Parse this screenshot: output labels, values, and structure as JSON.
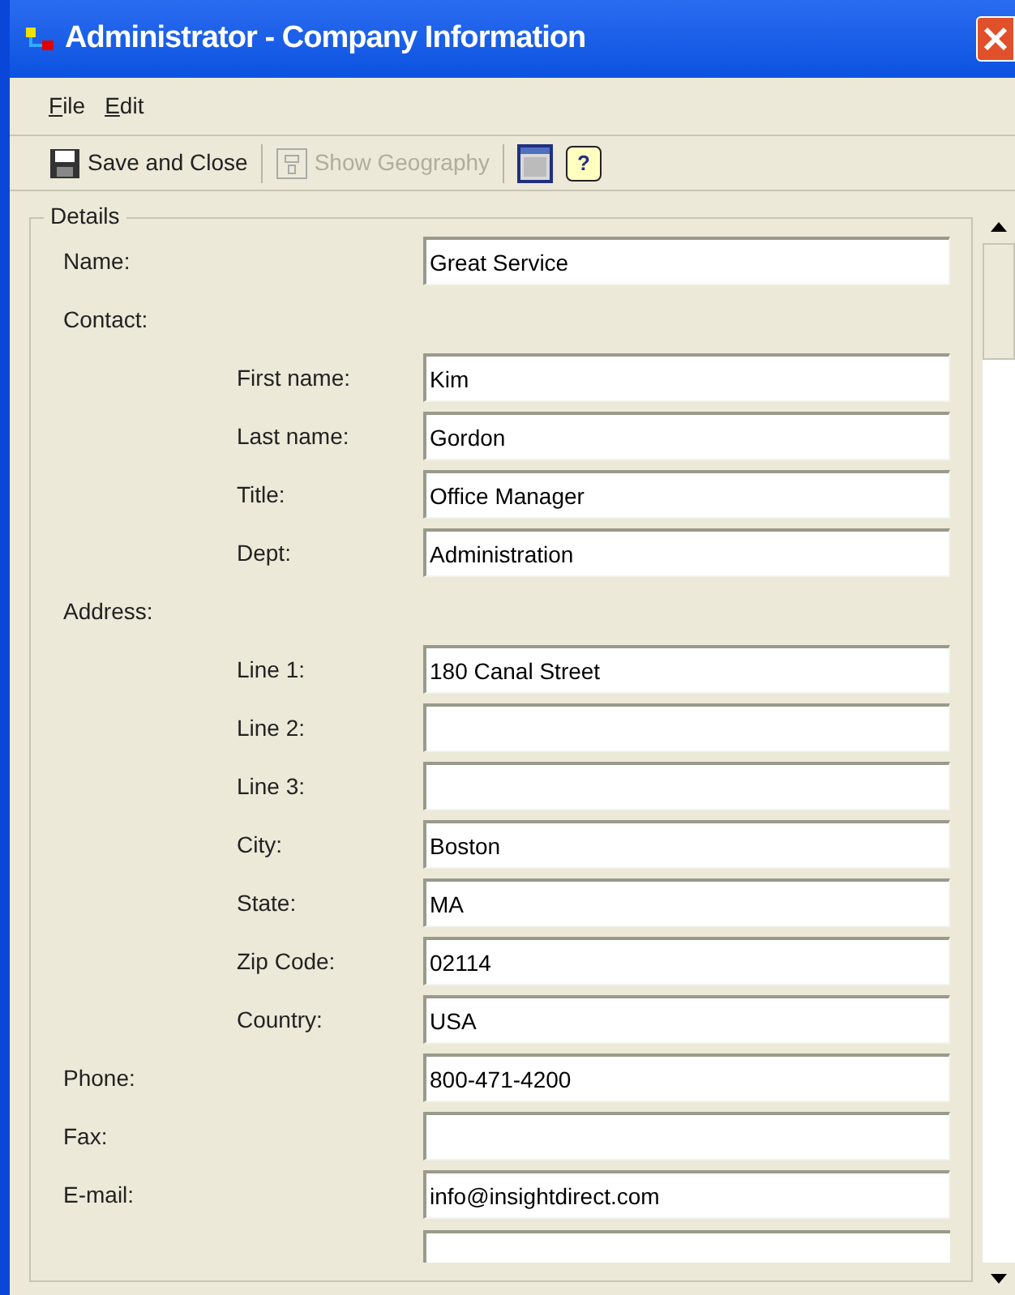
{
  "window": {
    "title": "Administrator - Company Information"
  },
  "menu": [
    {
      "label": "File"
    },
    {
      "label": "Edit"
    }
  ],
  "toolbar": [
    {
      "kind": "save",
      "label": "Save and Close",
      "disabled": false
    },
    {
      "kind": "geography",
      "label": "Show Geography",
      "disabled": true
    },
    {
      "kind": "layout",
      "disabled": false
    },
    {
      "kind": "help",
      "label": "?",
      "disabled": false
    }
  ],
  "details": {
    "title": "Details",
    "items": [
      {
        "kind": "field",
        "label": "Name:",
        "value": "Great Service"
      },
      {
        "kind": "group",
        "label": "Contact:",
        "children": [
          {
            "kind": "field",
            "label": "First name:",
            "value": "Kim"
          },
          {
            "kind": "field",
            "label": "Last name:",
            "value": "Gordon"
          },
          {
            "kind": "field",
            "label": "Title:",
            "value": "Office Manager"
          },
          {
            "kind": "field",
            "label": "Dept:",
            "value": "Administration"
          }
        ]
      },
      {
        "kind": "group",
        "label": "Address:",
        "children": [
          {
            "kind": "field",
            "label": "Line 1:",
            "value": "180 Canal Street"
          },
          {
            "kind": "field",
            "label": "Line 2:"
          },
          {
            "kind": "field",
            "label": "Line 3:"
          },
          {
            "kind": "field",
            "label": "City:",
            "value": "Boston"
          },
          {
            "kind": "field",
            "label": "State:",
            "value": "MA"
          },
          {
            "kind": "field",
            "label": "Zip Code:",
            "value": "02114"
          },
          {
            "kind": "field",
            "label": "Country:",
            "value": "USA"
          }
        ]
      },
      {
        "kind": "field",
        "label": "Phone:",
        "value": "800-471-4200"
      },
      {
        "kind": "field",
        "label": "Fax:"
      },
      {
        "kind": "field",
        "label": "E-mail:",
        "value": "info@insightdirect.com"
      },
      {
        "kind": "cut"
      }
    ]
  }
}
